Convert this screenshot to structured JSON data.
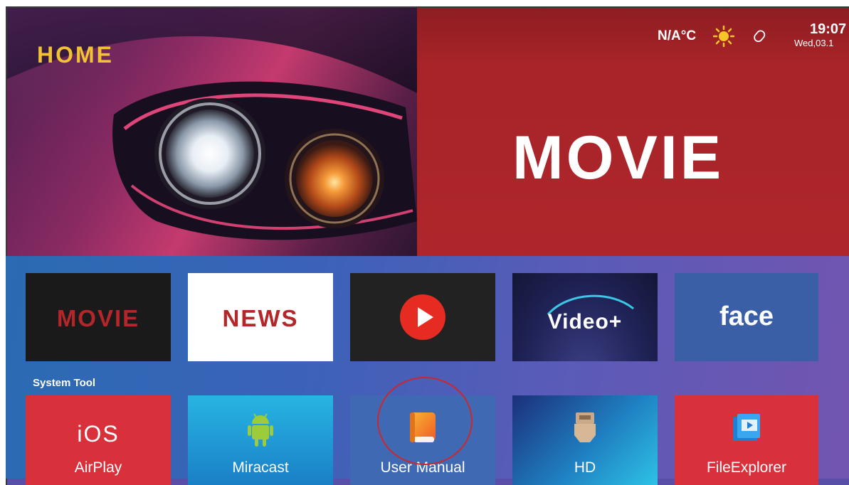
{
  "header": {
    "home_label": "HOME",
    "weather": "N/A°C",
    "weather_icon": "sun-icon",
    "time": "19:07",
    "date": "Wed,03.1"
  },
  "hero": {
    "title": "MOVIE",
    "accent_color": "#ad262b"
  },
  "apps_row": [
    {
      "label": "MOVIE",
      "color": "#b3262a"
    },
    {
      "label": "NEWS",
      "color": "#b3262a"
    },
    {
      "label": "",
      "icon": "youtube-play-icon"
    },
    {
      "label": "Video+",
      "icon": "video-plus-icon"
    },
    {
      "label": "face",
      "color": "#ffffff"
    }
  ],
  "system_tool": {
    "title": "System Tool",
    "items": [
      {
        "label": "AirPlay",
        "badge": "iOS"
      },
      {
        "label": "Miracast",
        "icon": "android-icon"
      },
      {
        "label": "User Manual",
        "icon": "book-icon"
      },
      {
        "label": "HD",
        "icon": "hdmi-icon"
      },
      {
        "label": "FileExplorer",
        "icon": "folder-icon"
      }
    ]
  }
}
